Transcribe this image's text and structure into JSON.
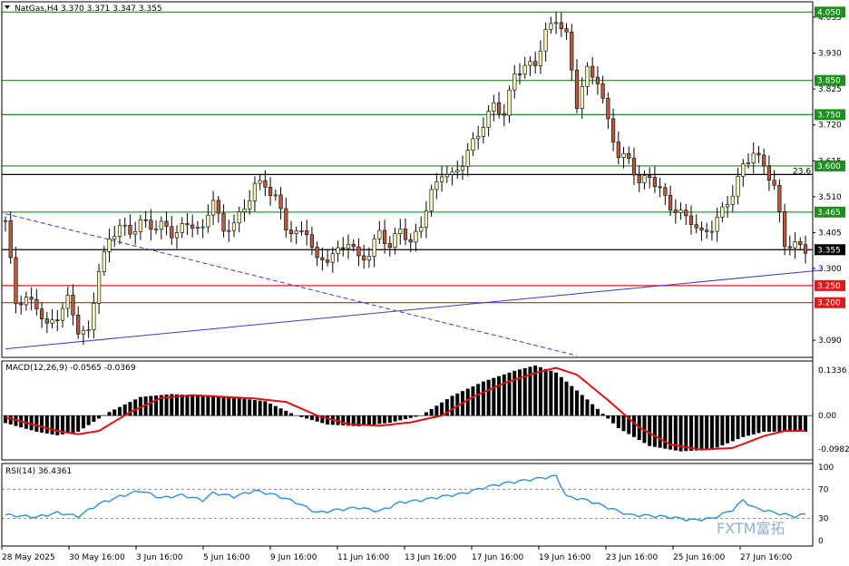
{
  "header": {
    "symbol_label": "NatGas,H4",
    "ohlc": "3.370 3.371 3.347 3.355"
  },
  "colors": {
    "bull_body": "#f5f5b8",
    "bear_body": "#b85a3c",
    "green_level": "#1e8f1e",
    "red_level": "#e01818",
    "black_level": "#000000",
    "trend_blue": "#3a3ad0",
    "macd_signal": "#e01010",
    "rsi_line": "#2e8fe0"
  },
  "watermark": "FXTM富拓",
  "chart_data": [
    {
      "type": "candlestick",
      "title": "",
      "ylim": [
        3.04,
        4.08
      ],
      "y_ticks": [
        "4.035",
        "3.930",
        "3.825",
        "3.720",
        "3.615",
        "3.510",
        "3.405",
        "3.300",
        "3.090"
      ],
      "x_ticks": [
        "28 May 2025",
        "30 May 16:00",
        "3 Jun 16:00",
        "5 Jun 16:00",
        "9 Jun 16:00",
        "11 Jun 16:00",
        "13 Jun 16:00",
        "17 Jun 16:00",
        "19 Jun 16:00",
        "23 Jun 16:00",
        "25 Jun 16:00",
        "27 Jun 16:00"
      ],
      "last_price": "3.355",
      "levels": [
        {
          "value": 4.05,
          "label": "4.050",
          "color": "green"
        },
        {
          "value": 3.85,
          "label": "3.850",
          "color": "green"
        },
        {
          "value": 3.75,
          "label": "3.750",
          "color": "green"
        },
        {
          "value": 3.6,
          "label": "3.600",
          "color": "green"
        },
        {
          "value": 3.575,
          "label": "",
          "color": "black"
        },
        {
          "value": 3.465,
          "label": "3.465",
          "color": "green"
        },
        {
          "value": 3.355,
          "label": "3.355",
          "color": "black"
        },
        {
          "value": 3.25,
          "label": "3.250",
          "color": "red"
        },
        {
          "value": 3.2,
          "label": "3.200",
          "color": "red"
        }
      ],
      "fib_label": {
        "text": "23.6",
        "value": 3.585
      },
      "trendlines": [
        {
          "style": "solid",
          "from": [
            0,
            3.065
          ],
          "to": [
            157,
            3.295
          ]
        },
        {
          "style": "dashed",
          "from": [
            0,
            3.46
          ],
          "to": [
            110,
            3.045
          ]
        }
      ],
      "close_path": [
        [
          0,
          3.44
        ],
        [
          2,
          3.2
        ],
        [
          4,
          3.21
        ],
        [
          6,
          3.19
        ],
        [
          8,
          3.13
        ],
        [
          10,
          3.16
        ],
        [
          12,
          3.21
        ],
        [
          14,
          3.12
        ],
        [
          16,
          3.11
        ],
        [
          18,
          3.3
        ],
        [
          20,
          3.38
        ],
        [
          22,
          3.43
        ],
        [
          24,
          3.4
        ],
        [
          26,
          3.44
        ],
        [
          28,
          3.42
        ],
        [
          30,
          3.43
        ],
        [
          32,
          3.4
        ],
        [
          34,
          3.42
        ],
        [
          36,
          3.43
        ],
        [
          38,
          3.41
        ],
        [
          40,
          3.51
        ],
        [
          42,
          3.4
        ],
        [
          44,
          3.44
        ],
        [
          46,
          3.47
        ],
        [
          48,
          3.55
        ],
        [
          50,
          3.54
        ],
        [
          52,
          3.51
        ],
        [
          54,
          3.42
        ],
        [
          56,
          3.4
        ],
        [
          58,
          3.41
        ],
        [
          60,
          3.32
        ],
        [
          62,
          3.33
        ],
        [
          64,
          3.35
        ],
        [
          66,
          3.38
        ],
        [
          68,
          3.33
        ],
        [
          70,
          3.34
        ],
        [
          72,
          3.41
        ],
        [
          74,
          3.36
        ],
        [
          76,
          3.42
        ],
        [
          78,
          3.37
        ],
        [
          80,
          3.43
        ],
        [
          82,
          3.52
        ],
        [
          84,
          3.58
        ],
        [
          86,
          3.57
        ],
        [
          88,
          3.61
        ],
        [
          90,
          3.67
        ],
        [
          92,
          3.72
        ],
        [
          94,
          3.78
        ],
        [
          96,
          3.75
        ],
        [
          98,
          3.87
        ],
        [
          100,
          3.89
        ],
        [
          102,
          3.9
        ],
        [
          104,
          3.99
        ],
        [
          106,
          4.03
        ],
        [
          108,
          3.98
        ],
        [
          110,
          3.78
        ],
        [
          112,
          3.88
        ],
        [
          114,
          3.85
        ],
        [
          116,
          3.73
        ],
        [
          118,
          3.63
        ],
        [
          120,
          3.62
        ],
        [
          122,
          3.55
        ],
        [
          124,
          3.57
        ],
        [
          126,
          3.53
        ],
        [
          128,
          3.48
        ],
        [
          130,
          3.46
        ],
        [
          132,
          3.44
        ],
        [
          134,
          3.4
        ],
        [
          136,
          3.42
        ],
        [
          138,
          3.47
        ],
        [
          140,
          3.52
        ],
        [
          142,
          3.6
        ],
        [
          144,
          3.64
        ],
        [
          146,
          3.6
        ],
        [
          148,
          3.54
        ],
        [
          150,
          3.37
        ],
        [
          152,
          3.37
        ],
        [
          154,
          3.355
        ]
      ]
    },
    {
      "type": "histogram",
      "title": "MACD(12,26,9) -0.0565 -0.0369",
      "y_ticks": [
        "0.1336",
        "0.00",
        "-0.0982"
      ],
      "ylim": [
        -0.13,
        0.16
      ],
      "signal_path": [
        [
          0,
          -0.005
        ],
        [
          10,
          -0.045
        ],
        [
          14,
          -0.055
        ],
        [
          18,
          -0.045
        ],
        [
          24,
          0.01
        ],
        [
          30,
          0.052
        ],
        [
          36,
          0.06
        ],
        [
          42,
          0.055
        ],
        [
          48,
          0.05
        ],
        [
          54,
          0.04
        ],
        [
          60,
          0.0
        ],
        [
          66,
          -0.025
        ],
        [
          72,
          -0.03
        ],
        [
          78,
          -0.02
        ],
        [
          84,
          0.0
        ],
        [
          90,
          0.055
        ],
        [
          96,
          0.095
        ],
        [
          102,
          0.125
        ],
        [
          106,
          0.14
        ],
        [
          110,
          0.12
        ],
        [
          116,
          0.045
        ],
        [
          122,
          -0.035
        ],
        [
          128,
          -0.085
        ],
        [
          134,
          -0.1
        ],
        [
          140,
          -0.095
        ],
        [
          146,
          -0.06
        ],
        [
          150,
          -0.045
        ],
        [
          154,
          -0.045
        ]
      ]
    },
    {
      "type": "line",
      "title": "RSI(14) 36.4361",
      "y_ticks": [
        "100",
        "70",
        "30",
        "0"
      ],
      "ylim": [
        0,
        100
      ],
      "series_path": [
        [
          0,
          35
        ],
        [
          6,
          32
        ],
        [
          10,
          38
        ],
        [
          14,
          33
        ],
        [
          18,
          50
        ],
        [
          22,
          60
        ],
        [
          26,
          68
        ],
        [
          30,
          58
        ],
        [
          34,
          62
        ],
        [
          38,
          55
        ],
        [
          40,
          65
        ],
        [
          44,
          60
        ],
        [
          48,
          68
        ],
        [
          52,
          62
        ],
        [
          56,
          52
        ],
        [
          60,
          38
        ],
        [
          64,
          42
        ],
        [
          68,
          45
        ],
        [
          72,
          40
        ],
        [
          76,
          52
        ],
        [
          80,
          55
        ],
        [
          84,
          60
        ],
        [
          88,
          64
        ],
        [
          92,
          72
        ],
        [
          96,
          78
        ],
        [
          100,
          82
        ],
        [
          104,
          86
        ],
        [
          106,
          88
        ],
        [
          108,
          60
        ],
        [
          112,
          55
        ],
        [
          116,
          45
        ],
        [
          120,
          35
        ],
        [
          124,
          34
        ],
        [
          128,
          32
        ],
        [
          132,
          28
        ],
        [
          136,
          30
        ],
        [
          140,
          42
        ],
        [
          142,
          55
        ],
        [
          144,
          45
        ],
        [
          148,
          38
        ],
        [
          152,
          33
        ],
        [
          154,
          36
        ]
      ]
    }
  ]
}
